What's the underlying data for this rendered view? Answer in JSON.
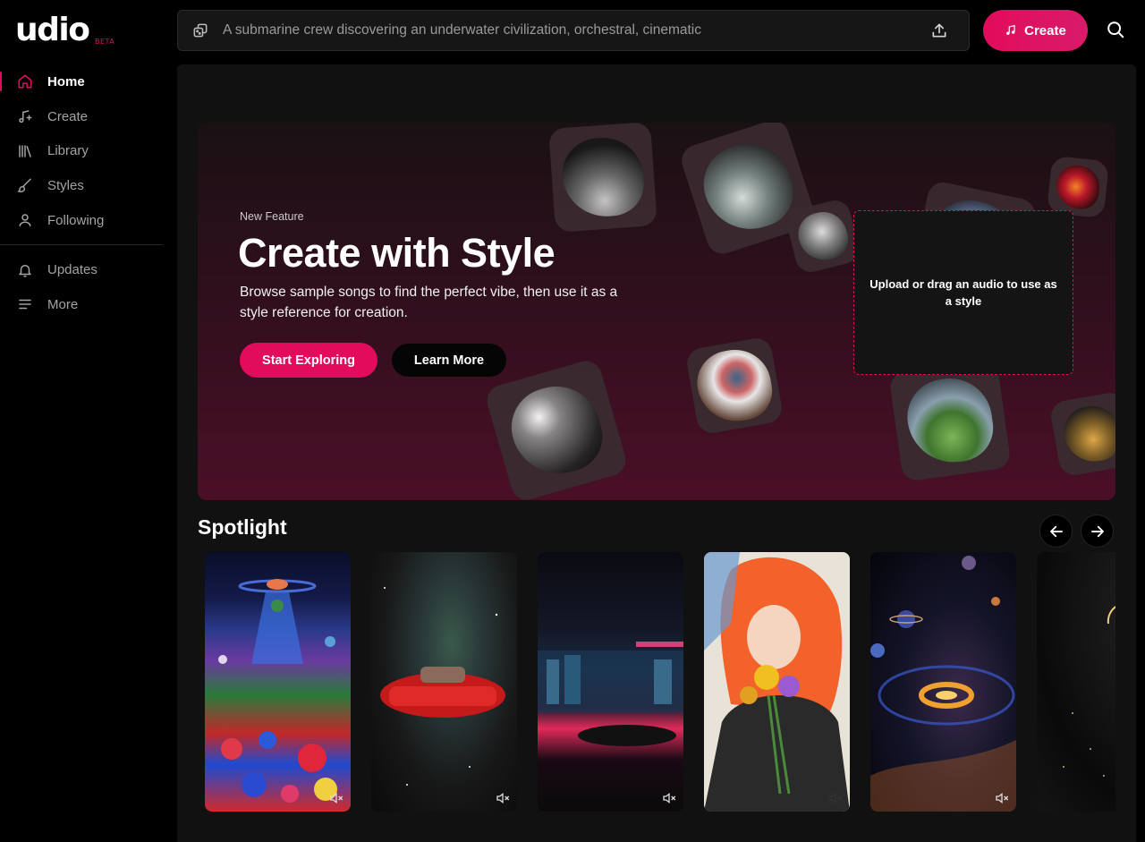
{
  "brand": {
    "name": "udio",
    "badge": "BETA"
  },
  "sidebar": {
    "items": [
      {
        "label": "Home",
        "icon": "home-icon"
      },
      {
        "label": "Create",
        "icon": "music-plus-icon"
      },
      {
        "label": "Library",
        "icon": "library-icon"
      },
      {
        "label": "Styles",
        "icon": "brush-icon"
      },
      {
        "label": "Following",
        "icon": "user-icon"
      }
    ],
    "secondary": [
      {
        "label": "Updates",
        "icon": "bell-icon"
      },
      {
        "label": "More",
        "icon": "menu-icon"
      }
    ]
  },
  "topbar": {
    "search_placeholder": "A submarine crew discovering an underwater civilization, orchestral, cinematic",
    "create_label": "Create"
  },
  "hero": {
    "tag": "New Feature",
    "title": "Create with Style",
    "subtitle": "Browse sample songs to find the perfect vibe, then use it as a style reference for creation.",
    "primary_label": "Start Exploring",
    "secondary_label": "Learn More",
    "dropzone_text": "Upload or drag an audio to use as a style"
  },
  "spotlight": {
    "title": "Spotlight",
    "cards": [
      {
        "name": "ufo-flower-field"
      },
      {
        "name": "red-car-nebula"
      },
      {
        "name": "neon-parking-city"
      },
      {
        "name": "flower-bouquet-portrait"
      },
      {
        "name": "galaxy-spiral"
      },
      {
        "name": "dark-horizon"
      }
    ]
  },
  "colors": {
    "accent": "#e30b5c",
    "background": "#000000",
    "panel": "#111111"
  }
}
